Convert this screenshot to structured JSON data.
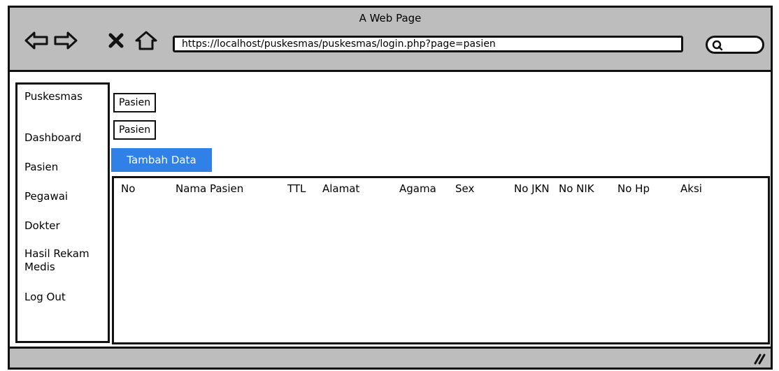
{
  "window": {
    "title": "A Web Page",
    "url": "https://localhost/puskesmas/puskesmas/login.php?page=pasien"
  },
  "toolbar": {
    "icons": [
      "back-arrow-icon",
      "forward-arrow-icon",
      "close-icon",
      "home-icon",
      "search-icon"
    ]
  },
  "sidebar": {
    "items": [
      {
        "label": "Puskesmas"
      },
      {
        "label": "Dashboard"
      },
      {
        "label": "Pasien"
      },
      {
        "label": "Pegawai"
      },
      {
        "label": "Dokter"
      },
      {
        "label": "Hasil Rekam Medis"
      },
      {
        "label": "Log Out"
      }
    ]
  },
  "main": {
    "breadcrumb1": "Pasien",
    "breadcrumb2": "Pasien",
    "add_button": "Tambah Data",
    "table": {
      "headers": [
        "No",
        "Nama Pasien",
        "TTL",
        "Alamat",
        "Agama",
        "Sex",
        "No JKN",
        "No NIK",
        "No Hp",
        "Aksi"
      ],
      "rows": []
    }
  },
  "colors": {
    "primary": "#2f80e7",
    "chrome": "#bdbdbd"
  }
}
